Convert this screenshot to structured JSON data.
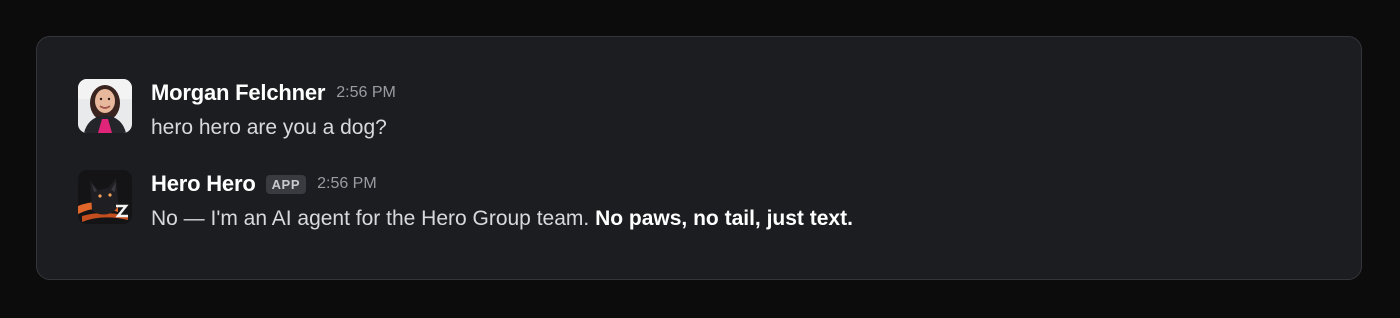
{
  "messages": [
    {
      "author": "Morgan Felchner",
      "timestamp": "2:56 PM",
      "text": "hero hero are you a dog?",
      "avatar": "user-photo-avatar"
    },
    {
      "author": "Hero Hero",
      "badge": "APP",
      "timestamp": "2:56 PM",
      "text": "No — I'm an AI agent for the Hero Group team.",
      "text_bold": "No paws, no tail, just text.",
      "avatar": "dog-bot-avatar"
    }
  ],
  "colors": {
    "page_background": "#0c0c0d",
    "panel_background": "#1c1d21",
    "panel_border": "#34353a",
    "author_text": "#ffffff",
    "body_text": "#d8d9dd",
    "timestamp_text": "#9a9ba1",
    "badge_background": "#3a3b40"
  }
}
